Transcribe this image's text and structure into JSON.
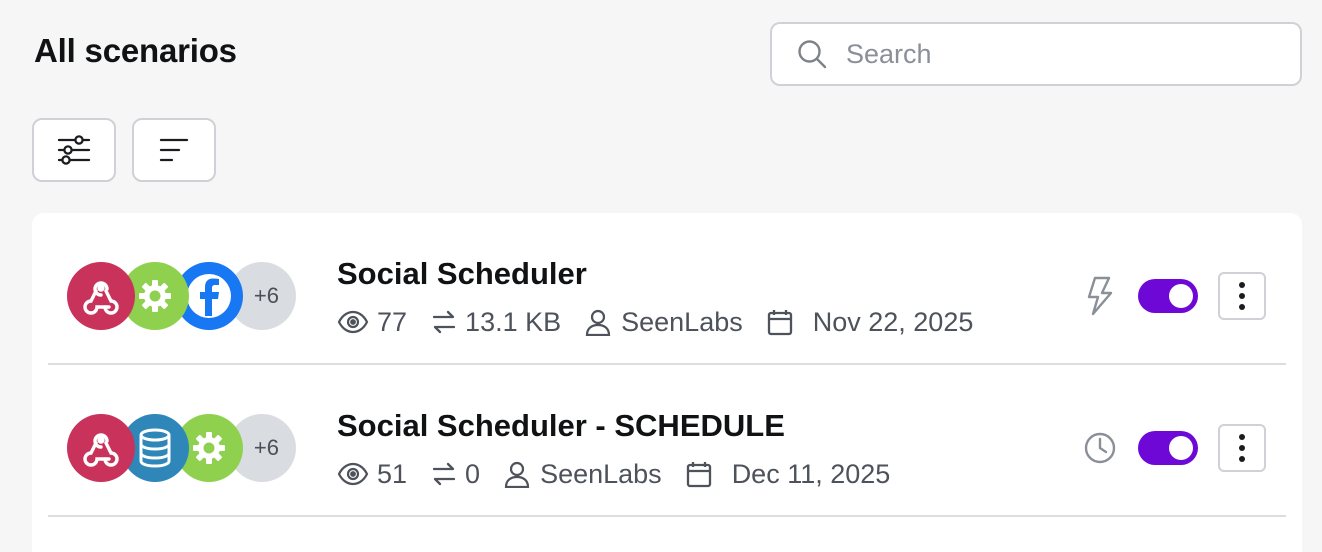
{
  "header": {
    "title": "All scenarios",
    "search_placeholder": "Search"
  },
  "toolbar": {
    "filter_icon": "sliders-icon",
    "sort_icon": "sort-lines-icon"
  },
  "scenarios": [
    {
      "name": "Social Scheduler",
      "apps": [
        "webhook",
        "tools",
        "facebook"
      ],
      "more_apps": "+6",
      "operations": "77",
      "data_transfer": "13.1 KB",
      "owner": "SeenLabs",
      "date": "Nov 22, 2025",
      "trigger_icon": "lightning-icon",
      "enabled": true
    },
    {
      "name": "Social Scheduler - SCHEDULE",
      "apps": [
        "webhook",
        "data-store",
        "tools"
      ],
      "more_apps": "+6",
      "operations": "51",
      "data_transfer": "0",
      "owner": "SeenLabs",
      "date": "Dec 11, 2025",
      "trigger_icon": "clock-icon",
      "enabled": true
    }
  ],
  "colors": {
    "webhook": "#c8325b",
    "tools": "#8fd14f",
    "facebook": "#1877f2",
    "data_store": "#2f86b8",
    "toggle_on": "#6d08d6"
  }
}
